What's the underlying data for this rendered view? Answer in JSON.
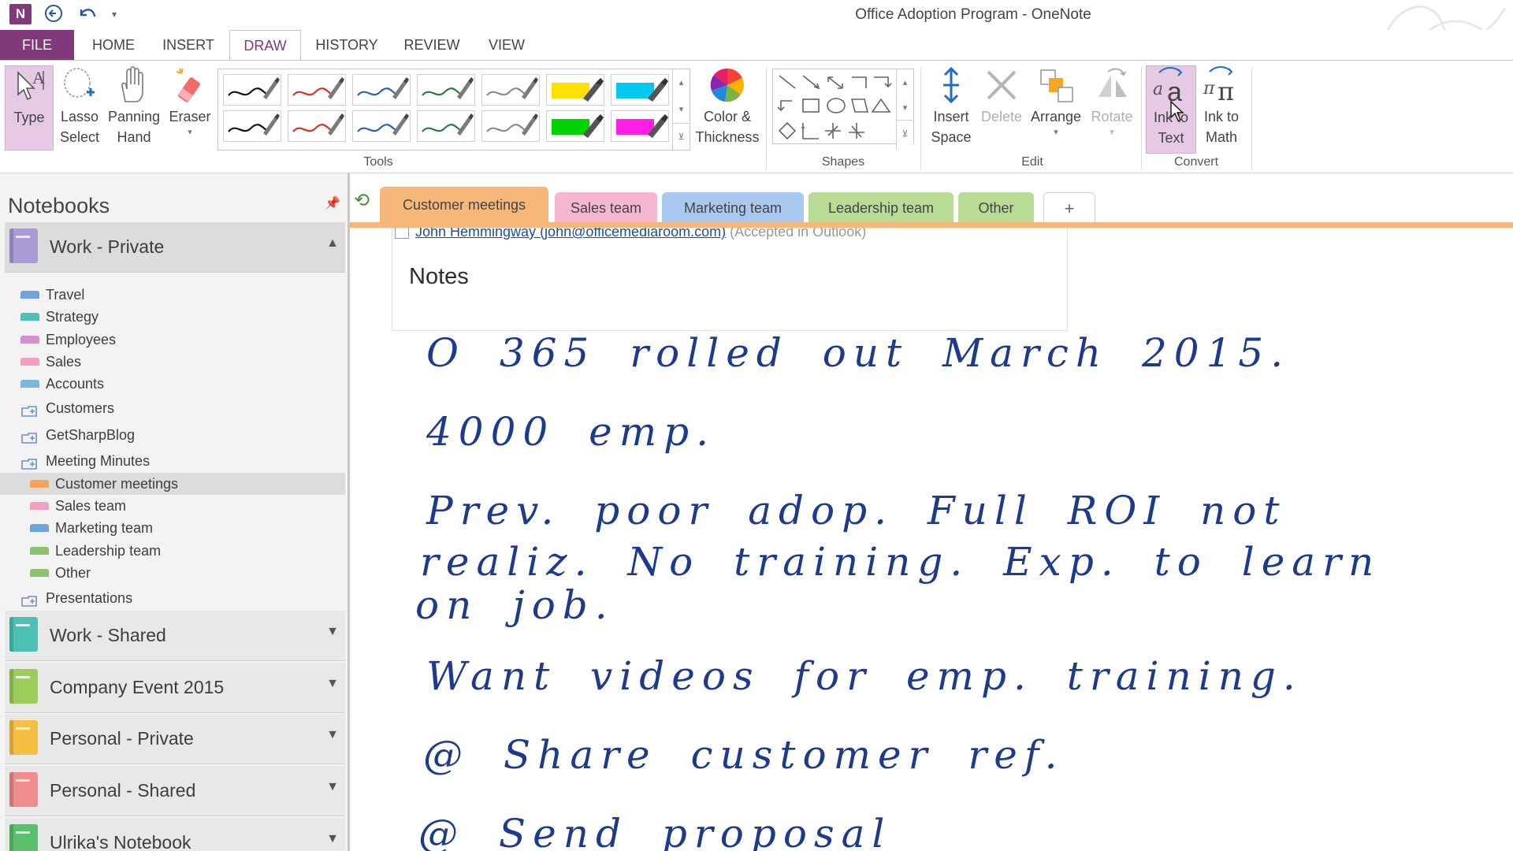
{
  "app": {
    "title": "Office Adoption Program - OneNote",
    "logo_text": "N"
  },
  "quick_access": {
    "back": "back",
    "undo": "undo",
    "customize": "customize"
  },
  "ribbon_tabs": [
    "FILE",
    "HOME",
    "INSERT",
    "DRAW",
    "HISTORY",
    "REVIEW",
    "VIEW"
  ],
  "active_ribbon_tab": "DRAW",
  "ribbon": {
    "tools": {
      "type": "Type",
      "lasso_1": "Lasso",
      "lasso_2": "Select",
      "panning_1": "Panning",
      "panning_2": "Hand",
      "eraser": "Eraser",
      "color_1": "Color &",
      "color_2": "Thickness",
      "group": "Tools"
    },
    "pens": [
      {
        "color": "#111111",
        "kind": "pen"
      },
      {
        "color": "#d9311f",
        "kind": "pen"
      },
      {
        "color": "#2b5fb3",
        "kind": "pen"
      },
      {
        "color": "#2a7a3c",
        "kind": "pen"
      },
      {
        "color": "#8a8a8a",
        "kind": "pen"
      },
      {
        "color": "#ffe100",
        "kind": "highlighter"
      },
      {
        "color": "#00c8f0",
        "kind": "highlighter"
      },
      {
        "color": "#111111",
        "kind": "pen"
      },
      {
        "color": "#d9311f",
        "kind": "pen"
      },
      {
        "color": "#2b5fb3",
        "kind": "pen"
      },
      {
        "color": "#2a7a3c",
        "kind": "pen"
      },
      {
        "color": "#8a8a8a",
        "kind": "pen"
      },
      {
        "color": "#00d400",
        "kind": "highlighter"
      },
      {
        "color": "#ff1ee6",
        "kind": "highlighter"
      }
    ],
    "shapes": {
      "group": "Shapes"
    },
    "edit": {
      "insert_1": "Insert",
      "insert_2": "Space",
      "delete": "Delete",
      "arrange": "Arrange",
      "rotate": "Rotate",
      "group": "Edit"
    },
    "convert": {
      "ink_text_1": "Ink to",
      "ink_text_2": "Text",
      "ink_math_1": "Ink to",
      "ink_math_2": "Math",
      "group": "Convert"
    }
  },
  "sidebar": {
    "header": "Notebooks",
    "open_notebook": {
      "name": "Work - Private",
      "color": "#a99bd6"
    },
    "sections": [
      {
        "label": "Travel",
        "color": "#6fa3dc",
        "kind": "section"
      },
      {
        "label": "Strategy",
        "color": "#4cc0b4",
        "kind": "section"
      },
      {
        "label": "Employees",
        "color": "#d48fd0",
        "kind": "section"
      },
      {
        "label": "Sales",
        "color": "#f0a0c0",
        "kind": "section"
      },
      {
        "label": "Accounts",
        "color": "#7ab8e0",
        "kind": "section"
      },
      {
        "label": "Customers",
        "color": "#6f8fc8",
        "kind": "group"
      },
      {
        "label": "GetSharpBlog",
        "color": "#6f8fc8",
        "kind": "group"
      },
      {
        "label": "Meeting Minutes",
        "color": "#6f8fc8",
        "kind": "group"
      },
      {
        "label": "Customer meetings",
        "color": "#f5a35c",
        "kind": "subsection"
      },
      {
        "label": "Sales team",
        "color": "#f0a0c0",
        "kind": "subsection"
      },
      {
        "label": "Marketing team",
        "color": "#6fa3dc",
        "kind": "subsection"
      },
      {
        "label": "Leadership team",
        "color": "#8cc26b",
        "kind": "subsection"
      },
      {
        "label": "Other",
        "color": "#8cc26b",
        "kind": "subsection"
      },
      {
        "label": "Presentations",
        "color": "#6f8fc8",
        "kind": "group"
      }
    ],
    "other_notebooks": [
      {
        "name": "Work - Shared",
        "color": "#4cc0b4"
      },
      {
        "name": "Company Event 2015",
        "color": "#9ccc5a"
      },
      {
        "name": "Personal - Private",
        "color": "#f5c042"
      },
      {
        "name": "Personal - Shared",
        "color": "#f08c8c"
      },
      {
        "name": "Ulrika's Notebook",
        "color": "#5cbf6e"
      }
    ]
  },
  "section_tabs": [
    {
      "label": "Customer meetings",
      "color": "#f6b77a"
    },
    {
      "label": "Sales team",
      "color": "#f7b6cf"
    },
    {
      "label": "Marketing team",
      "color": "#a9c8ef"
    },
    {
      "label": "Leadership team",
      "color": "#b8dc95"
    },
    {
      "label": "Other",
      "color": "#b8dc95"
    }
  ],
  "add_section": "+",
  "page": {
    "attendee_link": "John Hemmingway (john@officemediaroom.com)",
    "attendee_status": "(Accepted in Outlook)",
    "notes_heading": "Notes",
    "ink_lines": [
      "O 365 rolled out March 2015.",
      "4000 emp.",
      "Prev. poor adop. Full ROI not",
      "realiz. No training. Exp. to learn",
      "on job.",
      "Want videos for emp. training.",
      "@ Share customer ref.",
      "@ Send proposal"
    ]
  }
}
